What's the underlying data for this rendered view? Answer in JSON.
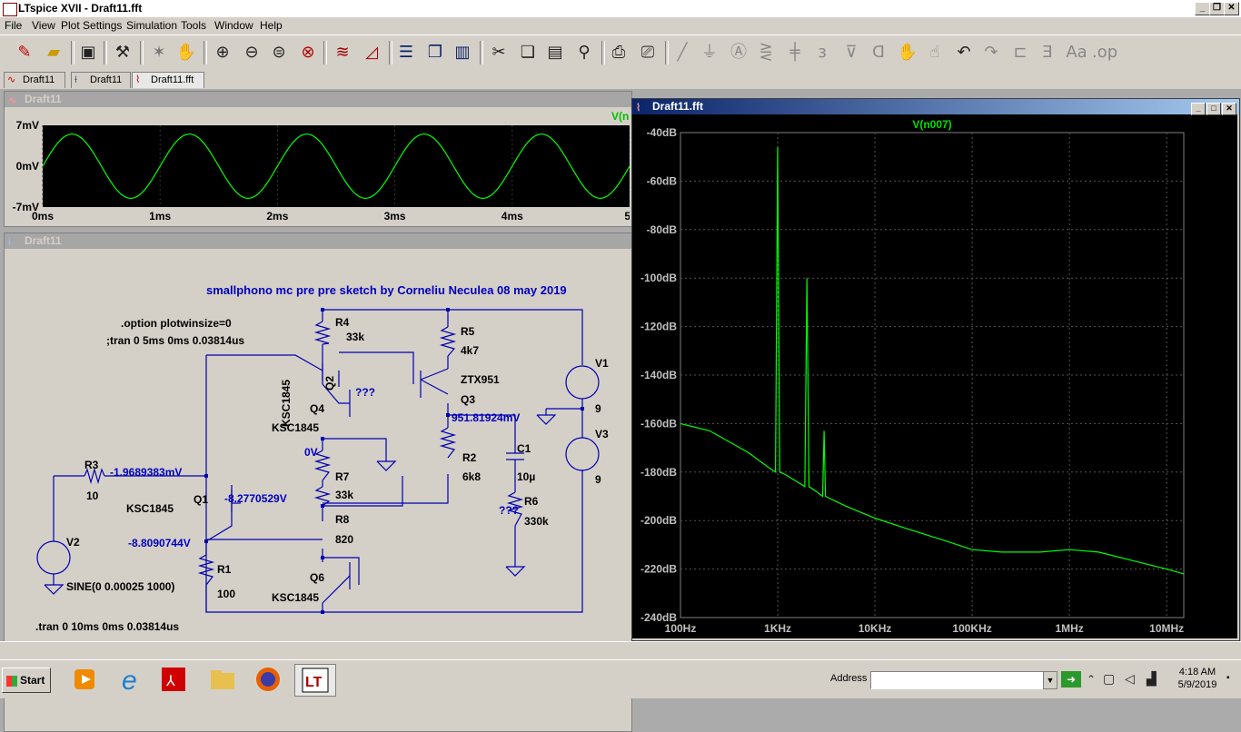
{
  "app": {
    "title": "LTspice XVII - Draft11.fft",
    "window_controls": [
      "_",
      "❐",
      "✕"
    ]
  },
  "menu": [
    "File",
    "View",
    "Plot Settings",
    "Simulation",
    "Tools",
    "Window",
    "Help"
  ],
  "toolbar_icons": [
    "new-schematic-icon",
    "open-folder-icon",
    "save-icon",
    "control-panel-icon",
    "run-icon",
    "halt-icon",
    "zoom-in-icon",
    "zoom-out-icon",
    "zoom-fit-icon",
    "cancel-zoom-icon",
    "autorange-icon",
    "plot-settings-icon",
    "tile-horizontal-icon",
    "cascade-icon",
    "tile-vertical-icon",
    "cut-icon",
    "copy-icon",
    "paste-icon",
    "find-icon",
    "print-preview-icon",
    "print-icon",
    "draw-wire-icon",
    "ground-icon",
    "label-net-icon",
    "resistor-icon",
    "capacitor-icon",
    "inductor-icon",
    "diode-icon",
    "component-icon",
    "move-icon",
    "drag-icon",
    "undo-icon",
    "redo-icon",
    "rotate-icon",
    "mirror-icon",
    "text-icon",
    "spice-directive-icon"
  ],
  "tabs": [
    {
      "label": "Draft11",
      "icon": "waveform-icon"
    },
    {
      "label": "Draft11",
      "icon": "schematic-icon"
    },
    {
      "label": "Draft11.fft",
      "icon": "fft-icon"
    }
  ],
  "waveform_window": {
    "title": "Draft11",
    "trace_label": "V(n",
    "trace_color": "#00ff00",
    "y_ticks": [
      "7mV",
      "0mV",
      "-7mV"
    ],
    "x_ticks": [
      "0ms",
      "1ms",
      "2ms",
      "3ms",
      "4ms",
      "5r"
    ]
  },
  "schematic_window": {
    "title": "Draft11",
    "header_text": "smallphono mc pre pre  sketch by Corneliu Neculea  08 may 2019",
    "directives": [
      ".option plotwinsize=0",
      ";tran 0 5ms 0ms 0.03814us",
      ".tran 0 10ms 0ms 0.03814us"
    ],
    "components": {
      "R4": "33k",
      "R5": "4k7",
      "R3": "10",
      "R7": "33k",
      "R8": "820",
      "R1": "100",
      "R2": "6k8",
      "R6": "330k",
      "C1": "10µ",
      "V1": "9",
      "V3": "9"
    },
    "transistors": {
      "Q2": "KSC1845",
      "Q4": "KSC1845",
      "Q3": "ZTX951",
      "Q1": "KSC1845",
      "Q6": "KSC1845"
    },
    "v2_source": "SINE(0 0.00025 1000)",
    "node_voltages": [
      "951.81924mV",
      "0V",
      "-1.9689383mV",
      "-8.2770529V",
      "-8.8090744V",
      "???",
      "???"
    ]
  },
  "fft_window": {
    "title": "Draft11.fft",
    "trace_label": "V(n007)",
    "trace_color": "#00ff00",
    "y_ticks": [
      "-40dB",
      "-60dB",
      "-80dB",
      "-100dB",
      "-120dB",
      "-140dB",
      "-160dB",
      "-180dB",
      "-200dB",
      "-220dB",
      "-240dB"
    ],
    "x_ticks": [
      "100Hz",
      "1KHz",
      "10KHz",
      "100KHz",
      "1MHz",
      "10MHz"
    ]
  },
  "chart_data": [
    {
      "type": "line",
      "title": "",
      "series": [
        {
          "name": "V(n",
          "x": [
            0,
            0.25,
            0.5,
            0.75,
            1,
            1.25,
            1.5,
            1.75,
            2,
            2.25,
            2.5,
            2.75,
            3,
            3.25,
            3.5,
            3.75,
            4,
            4.25,
            4.5,
            4.75,
            5
          ],
          "y": [
            0,
            5.5,
            0,
            -5.5,
            0,
            5.5,
            0,
            -5.5,
            0,
            5.5,
            0,
            -5.5,
            0,
            5.5,
            0,
            -5.5,
            0,
            5.5,
            0,
            -5.5,
            0
          ]
        }
      ],
      "xlabel": "",
      "ylabel": "",
      "xlim": [
        0,
        5
      ],
      "ylim": [
        -7,
        7
      ]
    },
    {
      "type": "line",
      "title": "",
      "series": [
        {
          "name": "V(n007)",
          "x": [
            100,
            200,
            500,
            800,
            950,
            1000,
            1050,
            1200,
            1900,
            2000,
            2100,
            2500,
            2900,
            3000,
            3100,
            5000,
            10000,
            20000,
            50000,
            100000,
            200000,
            500000,
            1000000,
            2000000,
            5000000,
            10000000,
            15000000
          ],
          "y": [
            -160,
            -163,
            -172,
            -178,
            -180,
            -46,
            -180,
            -181,
            -186,
            -100,
            -186,
            -188,
            -190,
            -163,
            -190,
            -194,
            -199,
            -203,
            -208,
            -212,
            -213,
            -213,
            -212,
            -213,
            -217,
            -220,
            -222
          ]
        }
      ],
      "xlabel": "",
      "ylabel": "",
      "xscale": "log",
      "xlim": [
        100,
        15000000
      ],
      "ylim": [
        -240,
        -40
      ]
    }
  ],
  "status_bar": {
    "address_label": "Address",
    "address_value": "",
    "clock_time": "4:18 AM",
    "clock_date": "5/9/2019"
  },
  "taskbar": {
    "start_label": "Start",
    "apps": [
      "media-player-icon",
      "internet-explorer-icon",
      "acrobat-icon",
      "file-explorer-icon",
      "firefox-icon",
      "ltspice-icon"
    ]
  }
}
